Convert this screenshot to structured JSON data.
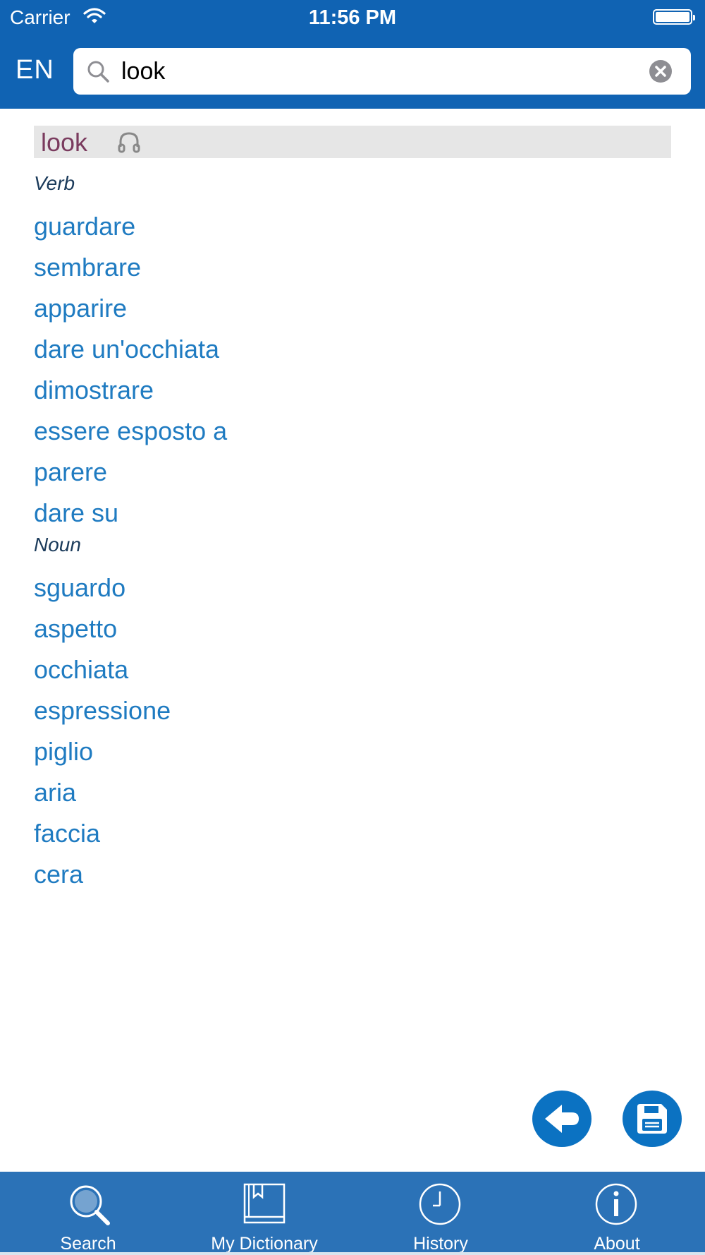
{
  "status_bar": {
    "carrier": "Carrier",
    "time": "11:56 PM"
  },
  "header": {
    "lang": "EN",
    "search_value": "look"
  },
  "entry": {
    "headword": "look",
    "sections": [
      {
        "pos": "Verb",
        "translations": [
          "guardare",
          "sembrare",
          "apparire",
          "dare un'occhiata",
          "dimostrare",
          "essere esposto a",
          "parere",
          "dare su"
        ]
      },
      {
        "pos": "Noun",
        "translations": [
          "sguardo",
          "aspetto",
          "occhiata",
          "espressione",
          "piglio",
          "aria",
          "faccia",
          "cera"
        ]
      }
    ]
  },
  "tabs": [
    {
      "label": "Search",
      "icon": "search-icon"
    },
    {
      "label": "My Dictionary",
      "icon": "book-icon"
    },
    {
      "label": "History",
      "icon": "clock-icon"
    },
    {
      "label": "About",
      "icon": "info-icon"
    }
  ],
  "colors": {
    "header": "#1063b3",
    "tabbar": "#2b72b7",
    "link": "#1f7bc1",
    "headword": "#7a3b5e",
    "fab": "#0b72c2"
  }
}
